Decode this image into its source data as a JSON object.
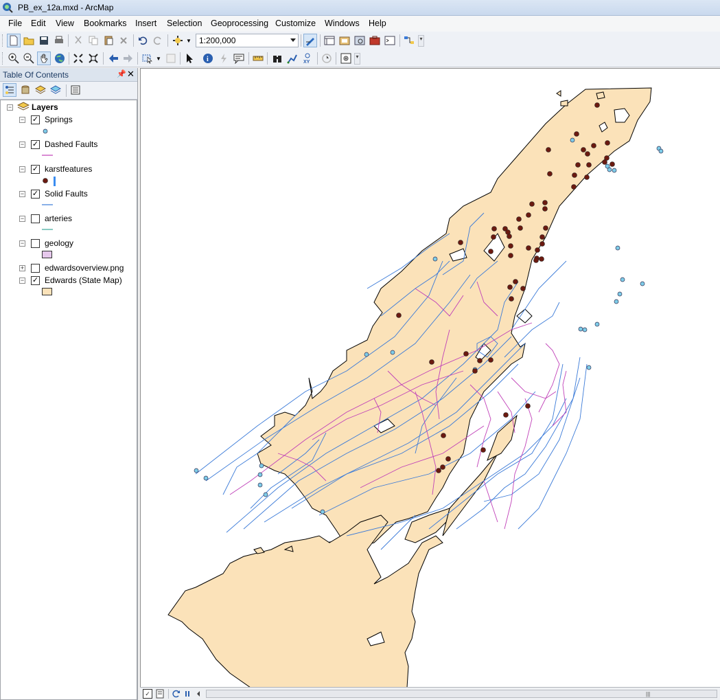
{
  "window": {
    "title": "PB_ex_12a.mxd - ArcMap",
    "app_icon": "arcmap-globe-icon"
  },
  "menu": [
    "File",
    "Edit",
    "View",
    "Bookmarks",
    "Insert",
    "Selection",
    "Geoprocessing",
    "Customize",
    "Windows",
    "Help"
  ],
  "toolbar": {
    "scale": "1:200,000"
  },
  "toc": {
    "title": "Table Of Contents",
    "pin_glyph": "📌",
    "close_glyph": "✕",
    "root": "Layers",
    "layers": [
      {
        "name": "Springs",
        "checked": true,
        "expanded": true,
        "symbol": "point",
        "color": "#7ecce8"
      },
      {
        "name": "Dashed Faults",
        "checked": true,
        "expanded": true,
        "symbol": "line",
        "color": "#c040b8"
      },
      {
        "name": "karstfeatures",
        "checked": true,
        "expanded": true,
        "symbol": "point-bar",
        "color": "#6b1a10",
        "bar_color": "#3a8cf0"
      },
      {
        "name": "Solid Faults",
        "checked": true,
        "expanded": true,
        "symbol": "line",
        "color": "#3a7ad8"
      },
      {
        "name": "arteries",
        "checked": false,
        "expanded": true,
        "symbol": "line",
        "color": "#3aa898"
      },
      {
        "name": "geology",
        "checked": false,
        "expanded": true,
        "symbol": "fill",
        "color": "#e6c8ec"
      },
      {
        "name": "edwardsoverview.png",
        "checked": false,
        "expanded": false,
        "symbol": "none",
        "color": ""
      },
      {
        "name": "Edwards (State Map)",
        "checked": true,
        "expanded": true,
        "symbol": "fill",
        "color": "#fbe2b9"
      }
    ]
  },
  "map": {
    "land_color": "#fbe2b9",
    "outline_color": "#000000",
    "solid_fault_color": "#3a7ad8",
    "dashed_fault_color": "#c040b8",
    "spring_color": "#7ecce8",
    "karst_color": "#6b1a10"
  },
  "status": {
    "checkbox_glyph": "✓"
  }
}
